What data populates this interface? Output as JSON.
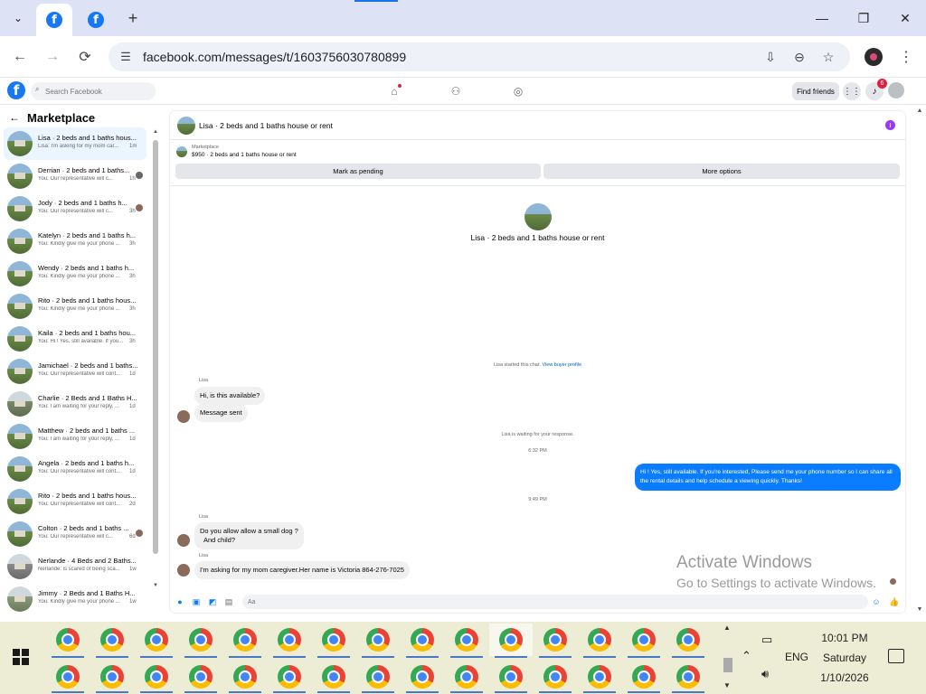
{
  "browser": {
    "url": "facebook.com/messages/t/1603756030780899",
    "tab_new": "+",
    "menu": "⌄"
  },
  "fb": {
    "logo": "f",
    "search_placeholder": "Search Facebook",
    "find_friends": "Find friends",
    "notifications_count": "6"
  },
  "sidebar": {
    "title": "Marketplace",
    "conversations": [
      {
        "title": "Lisa · 2 beds and 1 baths hous...",
        "preview": "Lisa: I'm asking for my mom car...",
        "time": "1m"
      },
      {
        "title": "Derrian · 2 beds and 1 baths...",
        "preview": "You: Our representative will c...",
        "time": "1h"
      },
      {
        "title": "Jody · 2 beds and 1 baths h...",
        "preview": "You: Our representative will c...",
        "time": "3h"
      },
      {
        "title": "Katelyn · 2 beds and 1 baths h...",
        "preview": "You: Kindly give me your phone ...",
        "time": "3h"
      },
      {
        "title": "Wendy · 2 beds and 1 baths h...",
        "preview": "You: Kindly give me your phone ...",
        "time": "3h"
      },
      {
        "title": "Rito · 2 beds and 1 baths hous...",
        "preview": "You: Kindly give me your phone ...",
        "time": "3h"
      },
      {
        "title": "Kaila · 2 beds and 1 baths hou...",
        "preview": "You: Hi ! Yes, still available. If you...",
        "time": "3h"
      },
      {
        "title": "Jamichael · 2 beds and 1 baths...",
        "preview": "You: Our representative will cont...",
        "time": "1d"
      },
      {
        "title": "Charlie · 2 Beds and 1 Baths H...",
        "preview": "You: I am waiting for your reply, ...",
        "time": "1d"
      },
      {
        "title": "Matthew · 2 beds and 1 baths ...",
        "preview": "You: I am waiting for your reply, ...",
        "time": "1d"
      },
      {
        "title": "Angela · 2 beds and 1 baths h...",
        "preview": "You: Our representative will cont...",
        "time": "1d"
      },
      {
        "title": "Rito · 2 beds and 1 baths hous...",
        "preview": "You: Our representative will cont...",
        "time": "2d"
      },
      {
        "title": "Colton · 2 beds and 1 baths ...",
        "preview": "You: Our representative will c...",
        "time": "6d"
      },
      {
        "title": "Nerlande · 4 Beds and 2 Baths...",
        "preview": "Nerlande: is scared of being sca...",
        "time": "1w"
      },
      {
        "title": "Jimmy · 2 Beds and 1 Baths H...",
        "preview": "You: Kindly give me your phone ...",
        "time": "1w"
      }
    ]
  },
  "chat": {
    "header_title": "Lisa · 2 beds and 1 baths house or rent",
    "marketplace_label": "Marketplace",
    "listing": "$950 · 2 beds and 1 baths house or rent",
    "btn_pending": "Mark as pending",
    "btn_more": "More options",
    "intro_title": "Lisa · 2 beds and 1 baths house or rent",
    "started_text": "Lisa started this chat.",
    "view_profile": "View buyer profile",
    "sender_name": "Lisa",
    "msg1": "Hi, is this available?",
    "msg2": "Message sent",
    "waiting": "Lisa is waiting for your response.",
    "time1": "6:32 PM",
    "reply": "Hi ! Yes, still available. If you're interested, Please send me your phone number so I can share all the rental details and help schedule a viewing quickly. Thanks!",
    "time2": "9:49 PM",
    "msg3_line1": "Do you allow allow a small dog ?",
    "msg3_line2": "And child?",
    "msg4": "I'm asking for my mom caregiver.Her name is Victoria 864-276-7025",
    "composer_placeholder": "Aa"
  },
  "watermark": {
    "line1": "Activate Windows",
    "line2": "Go to Settings to activate Windows."
  },
  "taskbar": {
    "lang": "ENG",
    "time": "10:01 PM",
    "day": "Saturday",
    "date": "1/10/2026"
  }
}
